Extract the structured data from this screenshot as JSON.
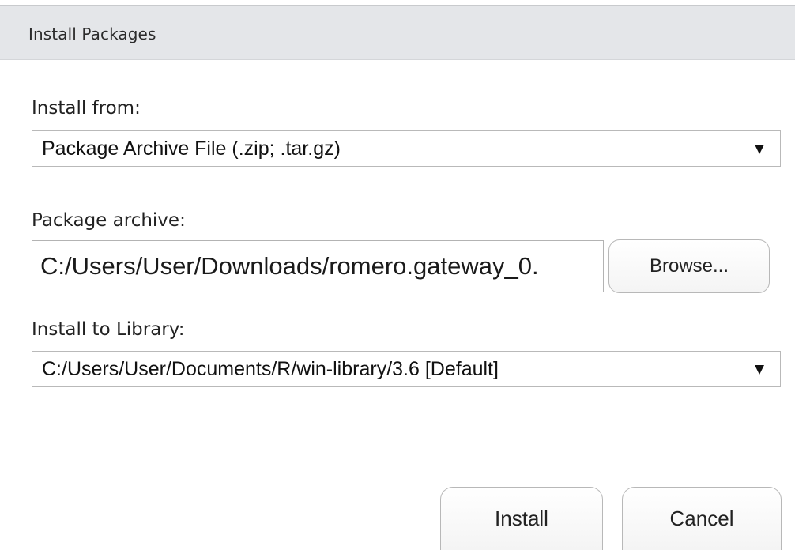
{
  "dialog": {
    "title": "Install Packages"
  },
  "install_from": {
    "label": "Install from:",
    "selected": "Package Archive File (.zip; .tar.gz)"
  },
  "package_archive": {
    "label": "Package archive:",
    "value": "C:/Users/User/Downloads/romero.gateway_0.",
    "browse_label": "Browse..."
  },
  "install_to": {
    "label": "Install to Library:",
    "selected": "C:/Users/User/Documents/R/win-library/3.6 [Default]"
  },
  "footer": {
    "install_label": "Install",
    "cancel_label": "Cancel"
  }
}
